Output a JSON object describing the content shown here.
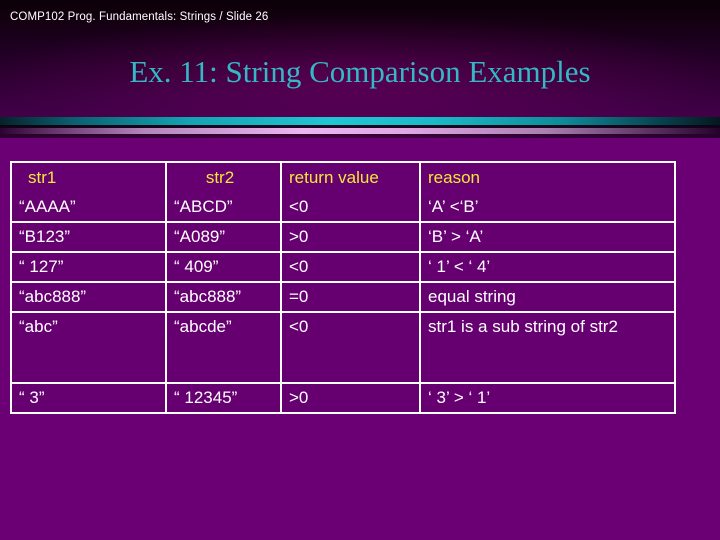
{
  "slide": {
    "header": "COMP102 Prog. Fundamentals: Strings / Slide 26",
    "title": "Ex. 11: String Comparison Examples"
  },
  "colors": {
    "background": "#6b0075",
    "title": "#35b7c4",
    "header_text": "#ffffff",
    "table_header_text": "#f5e63c",
    "table_body_text": "#ffffff",
    "reason_text": "#7ad84b",
    "table_border": "#ffffff",
    "bar_cyan": "#1fc7d2",
    "bar_pink": "#edb6ef"
  },
  "table": {
    "columns": [
      "str1",
      "str2",
      "return value",
      "reason"
    ],
    "rows": [
      {
        "str1": "“AAAA”",
        "str2": "“ABCD”",
        "return_value": "<0",
        "reason": "‘A’ <‘B’"
      },
      {
        "str1": "“B123”",
        "str2": "“A089”",
        "return_value": ">0",
        "reason": "‘B’ > ‘A’"
      },
      {
        "str1": "“ 127”",
        "str2": "“ 409”",
        "return_value": " <0",
        "reason": "‘ 1’ < ‘ 4’"
      },
      {
        "str1": "“abc888”",
        "str2": "“abc888”",
        "return_value": "=0",
        "reason": "equal string"
      },
      {
        "str1": "“abc”",
        "str2": "“abcde”",
        "return_value": "<0",
        "reason": "str1 is a sub string of str2"
      },
      {
        "str1": "“ 3”",
        "str2": "“ 12345”",
        "return_value": ">0",
        "reason": "‘ 3’ > ‘ 1’"
      }
    ]
  }
}
